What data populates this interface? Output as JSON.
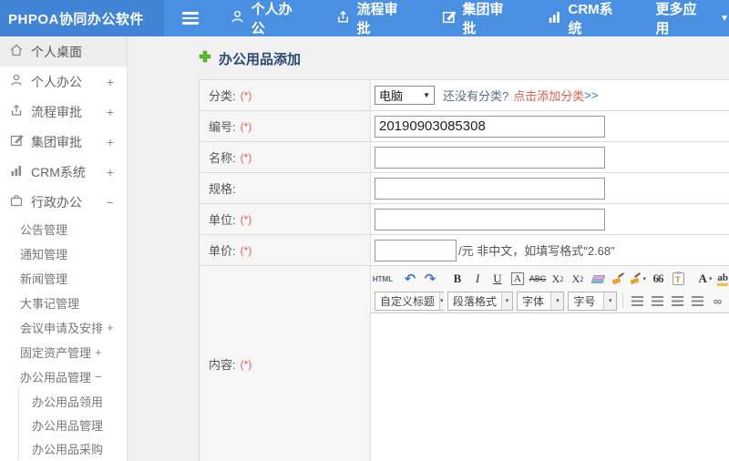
{
  "topbar": {
    "brand": "PHPOA协同办公软件",
    "menu": [
      {
        "label": "个人办公"
      },
      {
        "label": "流程审批"
      },
      {
        "label": "集团审批"
      },
      {
        "label": "CRM系统"
      },
      {
        "label": "更多应用"
      }
    ]
  },
  "sidebar": {
    "items": [
      {
        "label": "个人桌面",
        "expand": ""
      },
      {
        "label": "个人办公",
        "expand": "+"
      },
      {
        "label": "流程审批",
        "expand": "+"
      },
      {
        "label": "集团审批",
        "expand": "+"
      },
      {
        "label": "CRM系统",
        "expand": "+"
      },
      {
        "label": "行政办公",
        "expand": "−"
      },
      {
        "label": "公告管理",
        "expand": ""
      },
      {
        "label": "通知管理",
        "expand": ""
      },
      {
        "label": "新闻管理",
        "expand": ""
      },
      {
        "label": "大事记管理",
        "expand": ""
      },
      {
        "label": "会议申请及安排",
        "expand": "+"
      },
      {
        "label": "固定资产管理",
        "expand": "+"
      },
      {
        "label": "办公用品管理",
        "expand": "−"
      },
      {
        "label": "办公用品领用",
        "expand": ""
      },
      {
        "label": "办公用品管理",
        "expand": ""
      },
      {
        "label": "办公用品采购",
        "expand": ""
      }
    ]
  },
  "main": {
    "title": "办公用品添加",
    "form": {
      "category": {
        "label": "分类:",
        "required": "(*)",
        "selected": "电脑",
        "hint": "还没有分类?",
        "link": "点击添加分类",
        "arrows": ">>"
      },
      "code": {
        "label": "编号:",
        "required": "(*)",
        "value": "20190903085308"
      },
      "name": {
        "label": "名称:",
        "required": "(*)",
        "value": ""
      },
      "spec": {
        "label": "规格:",
        "value": ""
      },
      "unit": {
        "label": "单位:",
        "required": "(*)",
        "value": ""
      },
      "price": {
        "label": "单价:",
        "required": "(*)",
        "value": "",
        "suffix": "/元 非中文，如填写格式\"2.68\""
      },
      "content": {
        "label": "内容:",
        "required": "(*)"
      }
    },
    "editor": {
      "html_label": "HTML",
      "bold": "B",
      "italic": "I",
      "underline": "U",
      "char_border": "A",
      "strike": "ABC",
      "sup_base": "X",
      "sup_exp": "2",
      "sub_base": "X",
      "sub_exp": "2",
      "quote": "66",
      "paste_letter": "T",
      "font_color": "A",
      "highlight": "ab",
      "heading_select": "自定义标题",
      "format_select": "段落格式",
      "font_select": "字体",
      "size_select": "字号",
      "icons": {
        "undo": "↶",
        "redo": "↷",
        "caret_down": "▼",
        "caret_small": "▾",
        "link": "∞"
      }
    },
    "colors": {
      "topbar": "#4a90e2",
      "brand_bg": "#4184d5",
      "accent_red": "#e25b52",
      "link_blue": "#2f7cd3",
      "title_plus_green": "#5fb832"
    }
  }
}
